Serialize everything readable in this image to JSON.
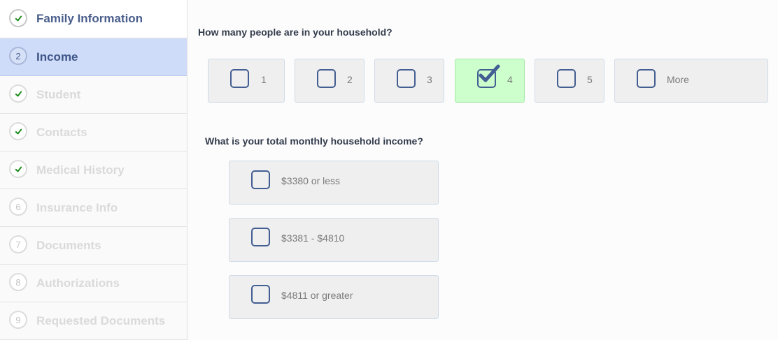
{
  "sidebar": {
    "steps": [
      {
        "number": "1",
        "label": "Family Information",
        "state": "complete"
      },
      {
        "number": "2",
        "label": "Income",
        "state": "active"
      },
      {
        "number": "3",
        "label": "Student",
        "state": "complete"
      },
      {
        "number": "4",
        "label": "Contacts",
        "state": "complete"
      },
      {
        "number": "5",
        "label": "Medical History",
        "state": "complete"
      },
      {
        "number": "6",
        "label": "Insurance Info",
        "state": "pending"
      },
      {
        "number": "7",
        "label": "Documents",
        "state": "pending"
      },
      {
        "number": "8",
        "label": "Authorizations",
        "state": "pending"
      },
      {
        "number": "9",
        "label": "Requested Documents",
        "state": "pending"
      }
    ],
    "check_icon": "checkmark-icon",
    "check_color": "#1a8a1a"
  },
  "main": {
    "household": {
      "question": "How many people are in your household?",
      "options": [
        {
          "label": "1",
          "checked": false
        },
        {
          "label": "2",
          "checked": false
        },
        {
          "label": "3",
          "checked": false
        },
        {
          "label": "4",
          "checked": true
        },
        {
          "label": "5",
          "checked": false
        },
        {
          "label": "More",
          "checked": false
        }
      ]
    },
    "income": {
      "question": "What is your total monthly household income?",
      "options": [
        {
          "label": "$3380 or less",
          "checked": false
        },
        {
          "label": "$3381 - $4810",
          "checked": false
        },
        {
          "label": "$4811 or greater",
          "checked": false
        }
      ]
    }
  },
  "colors": {
    "accent": "#435e92",
    "active_step_bg": "#cfdcf9",
    "checked_option_bg": "#ccffcc",
    "option_bg": "#efefef"
  }
}
